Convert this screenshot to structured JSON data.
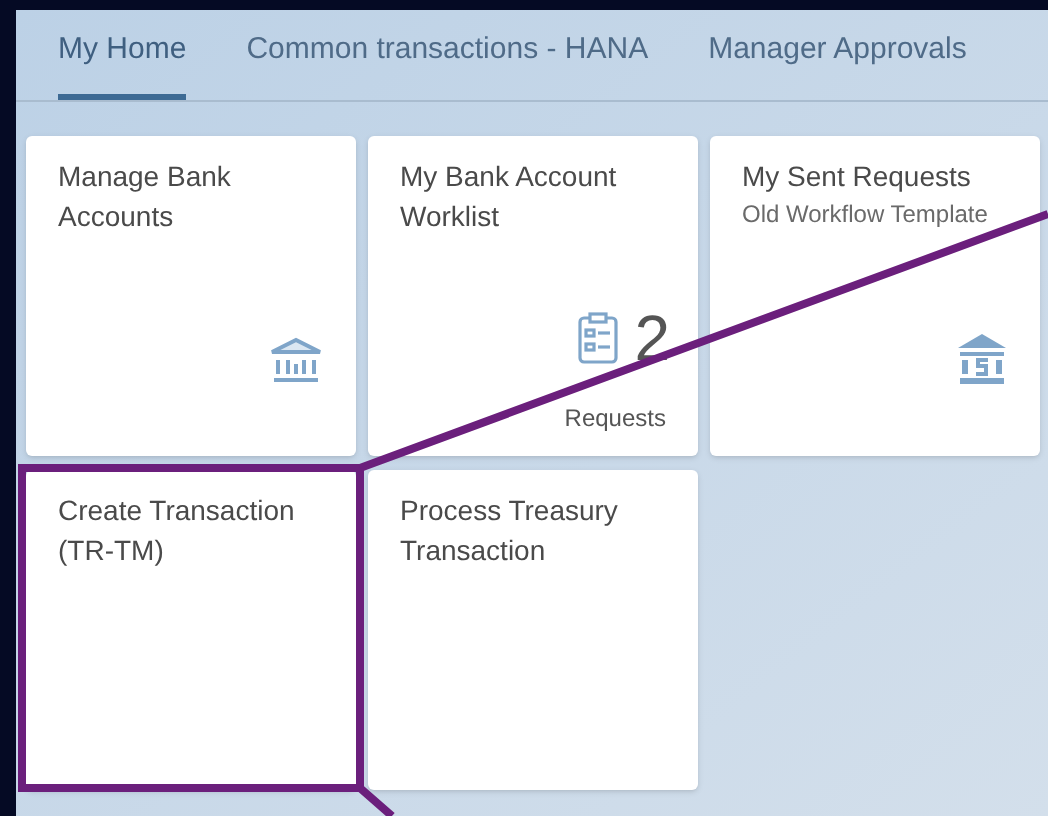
{
  "tabs": [
    {
      "label": "My Home",
      "selected": true
    },
    {
      "label": "Common transactions - HANA",
      "selected": false
    },
    {
      "label": "Manager Approvals",
      "selected": false
    }
  ],
  "tiles": [
    {
      "kind": "icon",
      "title": "Manage Bank Accounts",
      "highlighted": false
    },
    {
      "kind": "kpi",
      "title": "My Bank Account Worklist",
      "count": "2",
      "footer": "Requests",
      "highlighted": false
    },
    {
      "kind": "icon",
      "title": "My Sent Requests",
      "subtitle": "Old Workflow Template",
      "highlighted": false
    },
    {
      "kind": "plain",
      "title": "Create Transaction (TR-TM)",
      "highlighted": true
    },
    {
      "kind": "plain",
      "title": "Process Treasury Transaction",
      "highlighted": false
    }
  ]
}
